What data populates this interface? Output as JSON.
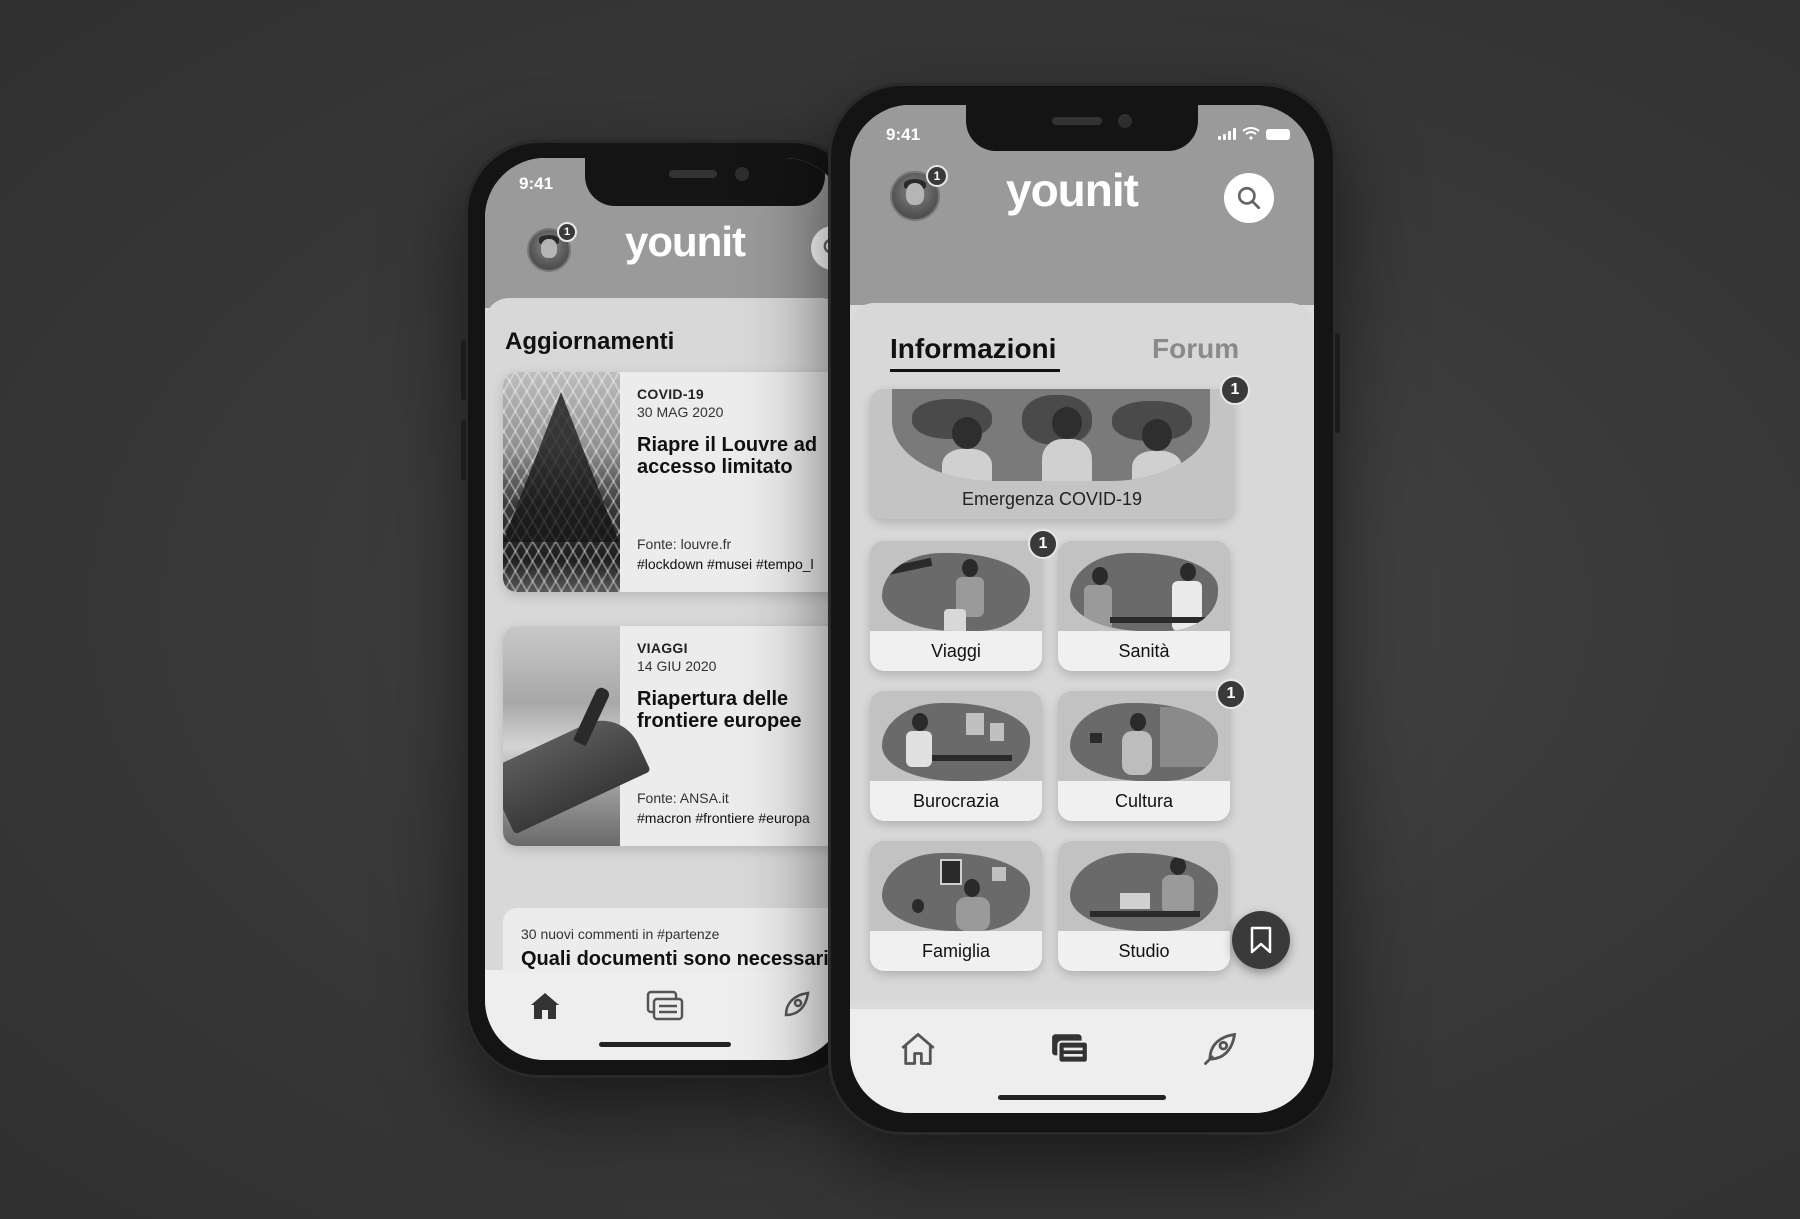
{
  "left_phone": {
    "status": {
      "time": "9:41"
    },
    "header": {
      "logo": "younit",
      "avatar_badge": "1"
    },
    "section_title": "Aggiornamenti",
    "news": [
      {
        "category": "COVID-19",
        "date": "30 MAG 2020",
        "title": "Riapre il Louvre ad accesso limitato",
        "source": "Fonte: louvre.fr",
        "tags": "#lockdown #musei #tempo_l"
      },
      {
        "category": "VIAGGI",
        "date": "14 GIU 2020",
        "title": "Riapertura delle frontiere europee",
        "source": "Fonte: ANSA.it",
        "tags": "#macron #frontiere #europa"
      }
    ],
    "forum_card": {
      "meta": "30 nuovi commenti in #partenze",
      "question": "Quali documenti sono necessari per viaggiare in Francia?"
    },
    "tabbar": {
      "icons": [
        "home-icon",
        "chat-icon",
        "rocket-icon"
      ]
    }
  },
  "right_phone": {
    "status": {
      "time": "9:41"
    },
    "header": {
      "logo": "younit",
      "avatar_badge": "1"
    },
    "tabs": [
      {
        "label": "Informazioni",
        "active": true
      },
      {
        "label": "Forum",
        "active": false
      }
    ],
    "featured": {
      "label": "Emergenza COVID-19",
      "badge": "1"
    },
    "categories": [
      {
        "label": "Viaggi",
        "badge": "1"
      },
      {
        "label": "Sanità",
        "badge": ""
      },
      {
        "label": "Burocrazia",
        "badge": ""
      },
      {
        "label": "Cultura",
        "badge": "1"
      },
      {
        "label": "Famiglia",
        "badge": ""
      },
      {
        "label": "Studio",
        "badge": ""
      }
    ],
    "tabbar": {
      "icons": [
        "home-icon",
        "chat-icon",
        "rocket-icon"
      ],
      "active": "chat-icon"
    }
  }
}
